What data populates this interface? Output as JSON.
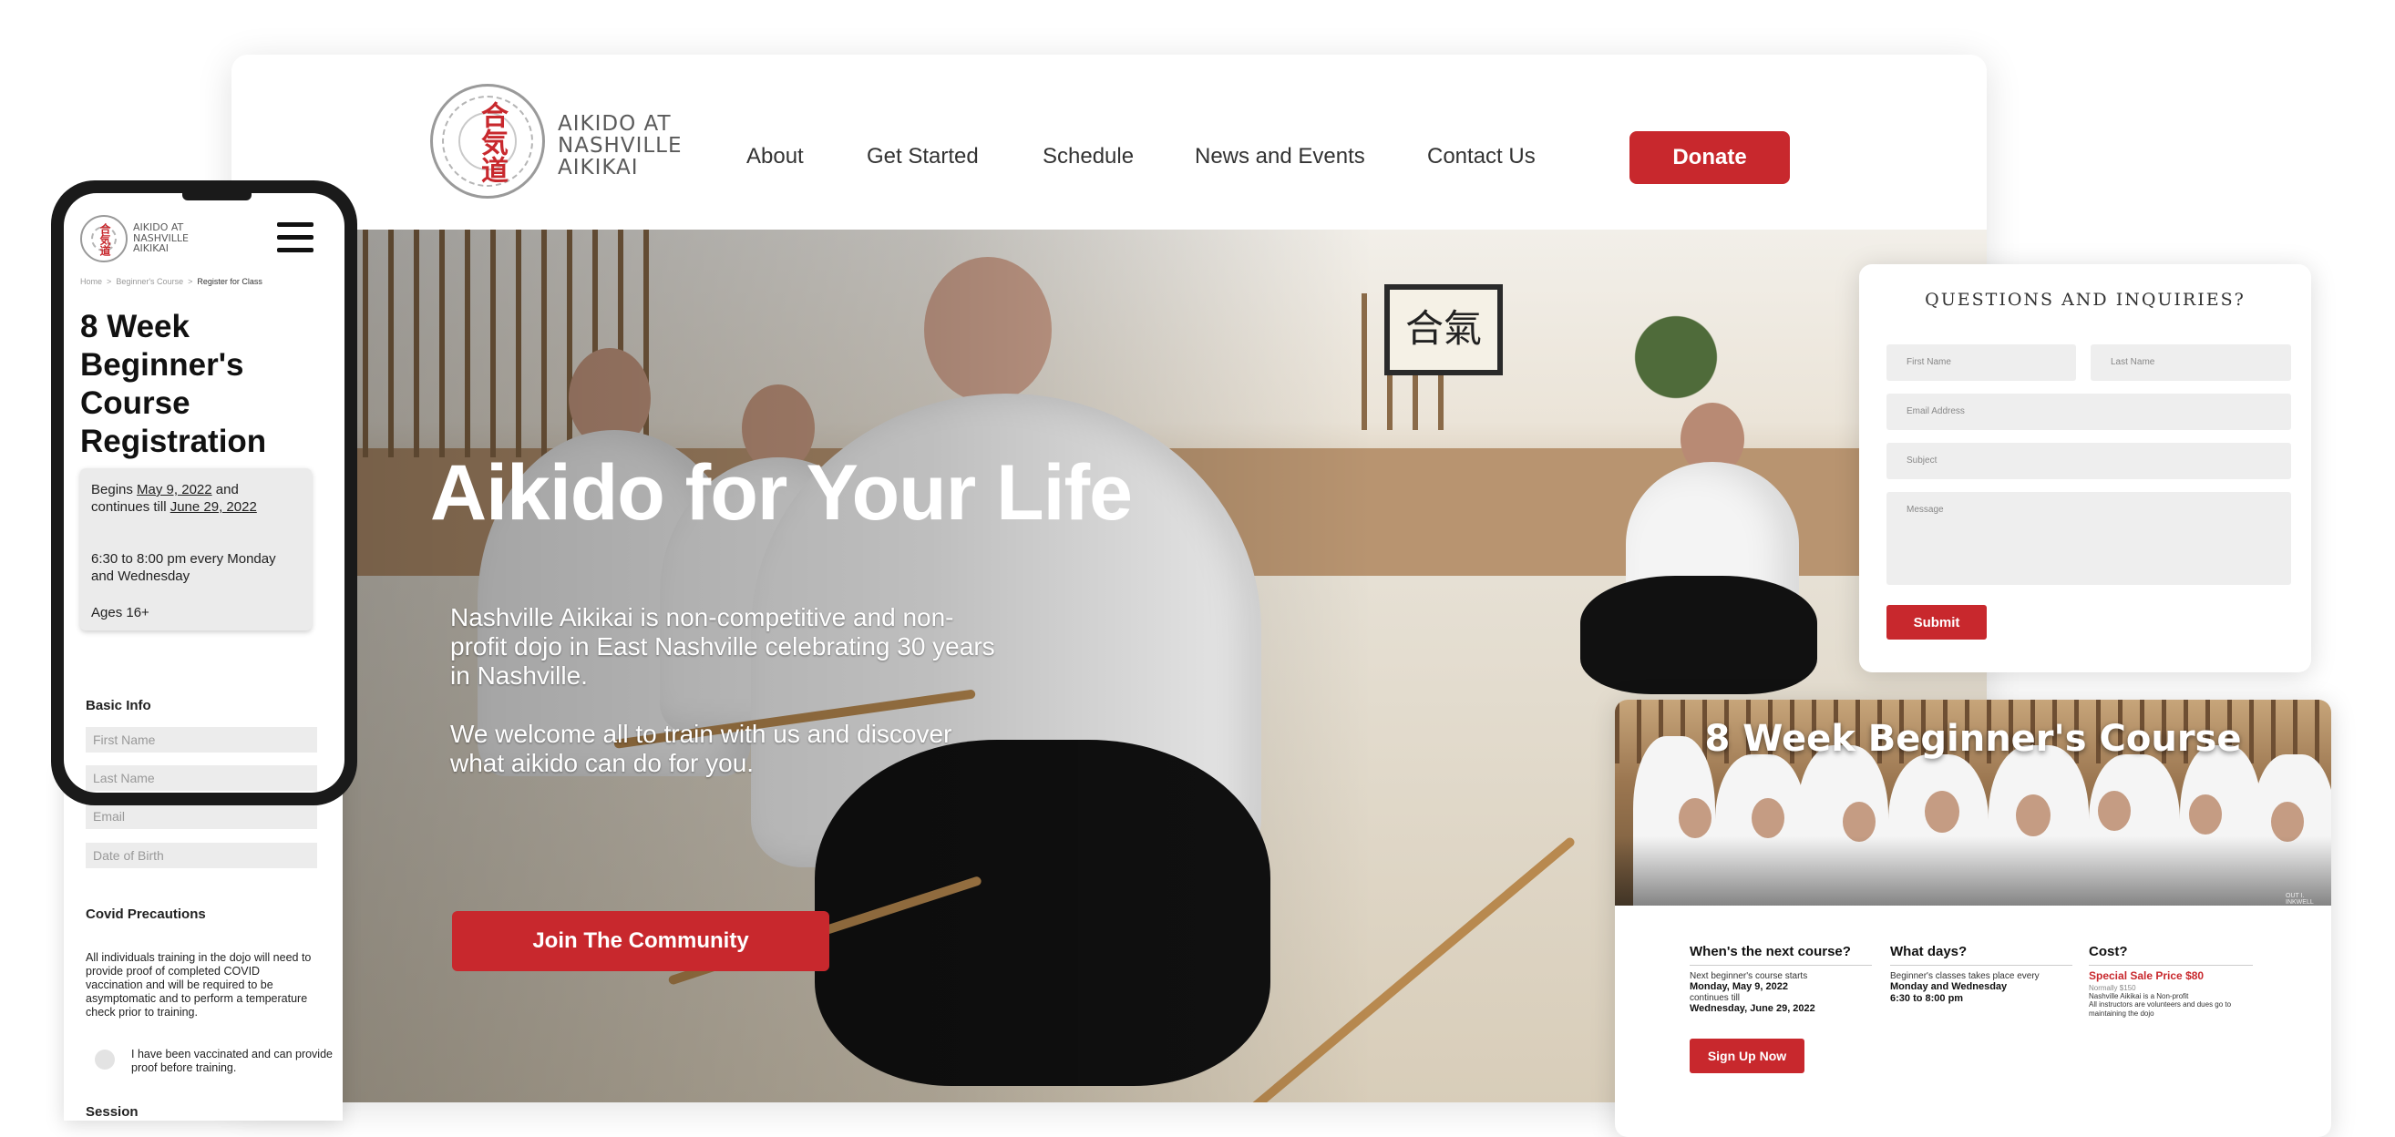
{
  "logo": {
    "kanji": "合気道",
    "text": "AIKIDO AT\nNASHVILLE\nAIKIKAI"
  },
  "nav": {
    "items": [
      "About",
      "Get Started",
      "Schedule",
      "News and Events",
      "Contact Us"
    ],
    "donate_label": "Donate"
  },
  "hero": {
    "title": "Aikido for Your Life",
    "paragraph1": "Nashville Aikikai is non-competitive and non-profit dojo in East Nashville celebrating 30 years in Nashville.",
    "paragraph2": "We welcome all to train with us and discover what aikido can do for you.",
    "cta_label": "Join The Community",
    "scroll_kanji": "合氣"
  },
  "phone": {
    "breadcrumb": [
      "Home",
      ">",
      "Beginner's Course",
      ">",
      "Register for Class"
    ],
    "title": "8 Week Beginner's Course Registration",
    "info": {
      "begins_prefix": "Begins ",
      "begins_date": "May 9, 2022",
      "continues_text": " and continues till ",
      "end_date": "June 29, 2022",
      "time": "6:30 to 8:00 pm every Monday and Wednesday",
      "ages": "Ages 16+"
    },
    "basic_info_label": "Basic Info",
    "fields": {
      "first_name": "First Name",
      "last_name": "Last Name",
      "email": "Email",
      "dob": "Date of Birth"
    },
    "covid_label": "Covid Precautions",
    "covid_text": "All individuals training in the dojo will need to provide proof of completed COVID vaccination and will be required to be asymptomatic and to perform a temperature check prior to training.",
    "vaccinated_label": "I have been vaccinated and can provide proof before training.",
    "session_label": "Session"
  },
  "questions": {
    "title": "QUESTIONS AND INQUIRIES?",
    "first_name": "First Name",
    "last_name": "Last Name",
    "email": "Email Address",
    "subject": "Subject",
    "message": "Message",
    "submit": "Submit"
  },
  "course": {
    "title": "8 Week Beginner's Course",
    "photo_caption": "OUT I. INKWELL",
    "col1": {
      "title": "When's the next course?",
      "line1": "Next beginner's course starts",
      "date1": "Monday, May 9, 2022",
      "line2": "continues till",
      "date2": "Wednesday, June 29, 2022"
    },
    "col2": {
      "title": "What days?",
      "line1": "Beginner's classes takes place every",
      "days": "Monday and Wednesday",
      "time": "6:30 to 8:00 pm"
    },
    "col3": {
      "title": "Cost?",
      "price": "Special Sale Price $80",
      "normal": "Normally $150",
      "note1": "Nashville Aikikai is a Non-profit",
      "note2": "All instructors are volunteers and dues go to maintaining the dojo"
    },
    "signup_label": "Sign Up Now"
  },
  "colors": {
    "brand_red": "#c8282d",
    "text_dark": "#222222",
    "input_bg": "#eeeeee"
  }
}
